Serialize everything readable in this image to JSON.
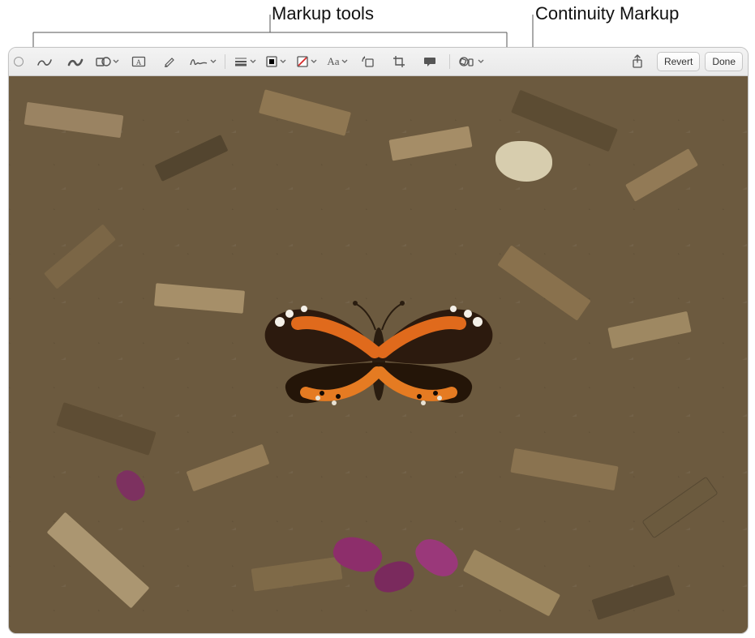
{
  "callouts": {
    "markup_tools": "Markup tools",
    "continuity_markup": "Continuity Markup"
  },
  "toolbar": {
    "buttons": {
      "revert": "Revert",
      "done": "Done"
    },
    "text_style_label": "Aa",
    "icons": {
      "window_control": "window-control",
      "sketch": "sketch-icon",
      "draw": "draw-icon",
      "shapes": "shapes-icon",
      "text": "text-icon",
      "highlight": "highlight-icon",
      "sign": "sign-icon",
      "shape_style": "shape-style-icon",
      "border_color": "border-color-icon",
      "fill_color": "fill-color-icon",
      "text_style": "text-style-icon",
      "rotate": "rotate-icon",
      "crop": "crop-icon",
      "image_description": "image-description-icon",
      "continuity_markup": "continuity-markup-icon",
      "share": "share-icon"
    },
    "colors": {
      "border_swatch": "#000000",
      "fill_swatch_stroke": "#d62828"
    }
  },
  "image": {
    "description": "Photo of a Red Admiral butterfly resting on brown wood-chip mulch with scattered magenta flower petals."
  }
}
